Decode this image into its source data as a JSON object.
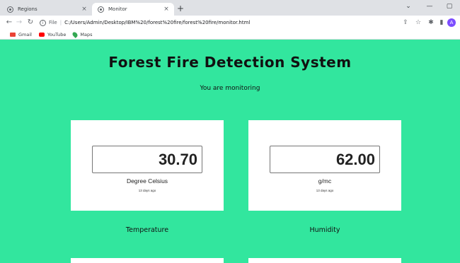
{
  "browser": {
    "tabs": [
      {
        "title": "Regions",
        "active": false
      },
      {
        "title": "Monitor",
        "active": true
      }
    ],
    "new_tab": "+",
    "tab_close": "×",
    "window_controls": {
      "dropdown": "⌄",
      "minimize": "—",
      "maximize": "▢"
    },
    "omnibox": {
      "scheme": "File",
      "url": "C:/Users/Admin/Desktop/IBM%20/forest%20fire/forest%20fire/monitor.html"
    },
    "profile_initial": "A",
    "bookmarks": [
      {
        "label": "Gmail",
        "icon": "gmail-icon"
      },
      {
        "label": "YouTube",
        "icon": "youtube-icon"
      },
      {
        "label": "Maps",
        "icon": "maps-icon"
      }
    ]
  },
  "page": {
    "background_color": "#32e69e",
    "title": "Forest Fire Detection System",
    "subtitle": "You are monitoring",
    "cards": {
      "temperature": {
        "value": "30.70",
        "unit": "Degree Celsius",
        "updated": "13 days ago",
        "label": "Temperature"
      },
      "humidity": {
        "value": "62.00",
        "unit": "g/mc",
        "updated": "13 days ago",
        "label": "Humidity"
      }
    }
  }
}
